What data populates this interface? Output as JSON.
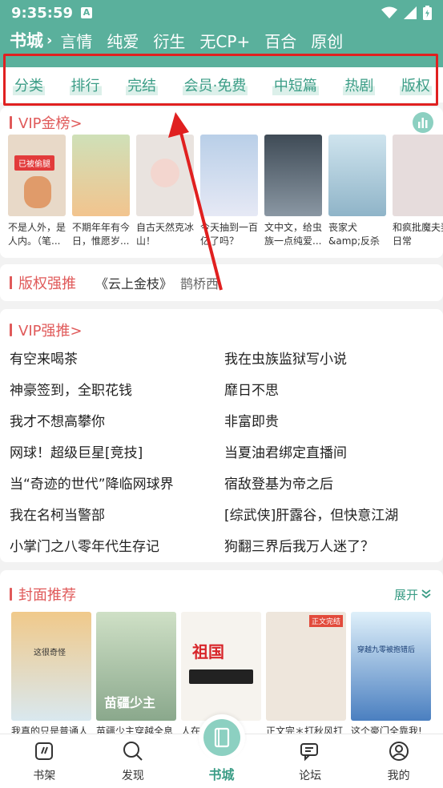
{
  "status": {
    "time": "9:35:59",
    "alert_glyph": "A"
  },
  "header": {
    "title": "书城",
    "genres": [
      "言情",
      "纯爱",
      "衍生",
      "无CP+",
      "百合",
      "原创"
    ]
  },
  "quick_nav": [
    "分类",
    "排行",
    "完结",
    "会员·免费",
    "中短篇",
    "热剧",
    "版权"
  ],
  "vip_rank": {
    "title": "VIP金榜>",
    "badge": "已被偷腿",
    "books": [
      {
        "caption": "不是人外，是人内。（笔...",
        "color": "#e8d9c8"
      },
      {
        "caption": "不期年年有今日，惟愿岁...",
        "color": "#f2c48e"
      },
      {
        "caption": "自古天然克冰山！",
        "color": "#e9e3df"
      },
      {
        "caption": "今天抽到一百亿了吗？",
        "color": "#b9cfe8"
      },
      {
        "caption": "文中文，给虫族一点纯爱...",
        "color": "#5c6a78"
      },
      {
        "caption": "丧家犬&amp;反杀黑天鹅",
        "color": "#a9c8d8"
      },
      {
        "caption": "和疯批魔夫妻日常",
        "color": "#e6dcdc"
      }
    ]
  },
  "copyright_push": {
    "title": "版权强推",
    "book": "《云上金枝》",
    "author": "鹊桥西"
  },
  "vip_push": {
    "title": "VIP强推>",
    "items": [
      "有空来喝茶",
      "我在虫族监狱写小说",
      "神豪签到，全职花钱",
      "靡日不思",
      "我才不想高攀你",
      "非富即贵",
      "网球！超级巨星[竞技]",
      "当夏油君绑定直播间",
      "当“奇迹的世代”降临网球界",
      "宿敌登基为帝之后",
      "我在名柯当警部",
      "[综武侠]肝露谷，但快意江湖",
      "小掌门之八零年代生存记",
      "狗翻三界后我万人迷了？"
    ]
  },
  "cover_rec": {
    "title": "封面推荐",
    "expand": "展开",
    "books": [
      {
        "caption": "我真的只是普通人",
        "color": "#f0c98a"
      },
      {
        "caption": "苗疆少主穿越全息",
        "color": "#9ab894"
      },
      {
        "caption": "人在……祖国",
        "color": "#f6f3ee"
      },
      {
        "caption": "正文完＊打秋风打",
        "color": "#eee6dc"
      },
      {
        "caption": "这个豪门全靠我!",
        "color": "#4a7fc0"
      }
    ],
    "cover_texts": [
      "这很奇怪",
      "苗疆少主",
      "祖国",
      "正文完结",
      "穿越九零被抱错后"
    ]
  },
  "tabs": [
    "书架",
    "发现",
    "书城",
    "论坛",
    "我的"
  ]
}
